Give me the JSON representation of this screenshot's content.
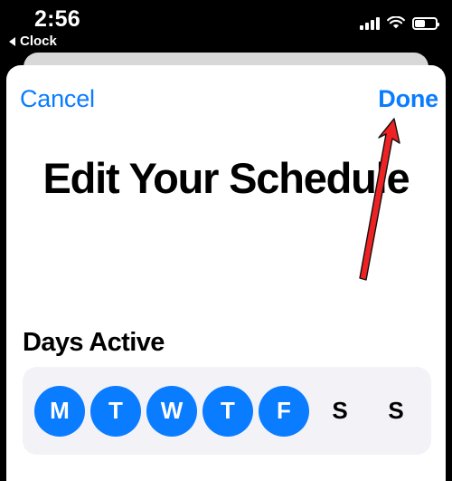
{
  "status_bar": {
    "time": "2:56",
    "back_label": "Clock",
    "back_icon": "triangle-left-icon",
    "signal_icon": "cellular-signal-icon",
    "signal_bars_filled": 3,
    "signal_bars_total": 4,
    "wifi_icon": "wifi-icon",
    "battery_icon": "battery-icon",
    "battery_percent": 50
  },
  "sheet": {
    "cancel_label": "Cancel",
    "done_label": "Done",
    "title": "Edit Your Schedule",
    "accent_color": "#0A7CFF",
    "background_color": "#FFFFFF",
    "card_background_color": "#F2F2F7"
  },
  "section": {
    "header": "Days Active",
    "days": [
      {
        "label": "M",
        "name": "monday",
        "selected": true
      },
      {
        "label": "T",
        "name": "tuesday",
        "selected": true
      },
      {
        "label": "W",
        "name": "wednesday",
        "selected": true
      },
      {
        "label": "T",
        "name": "thursday",
        "selected": true
      },
      {
        "label": "F",
        "name": "friday",
        "selected": true
      },
      {
        "label": "S",
        "name": "saturday",
        "selected": false
      },
      {
        "label": "S",
        "name": "sunday",
        "selected": false
      }
    ]
  },
  "annotation": {
    "arrow_color": "#EE2222",
    "points_at": "Done"
  }
}
